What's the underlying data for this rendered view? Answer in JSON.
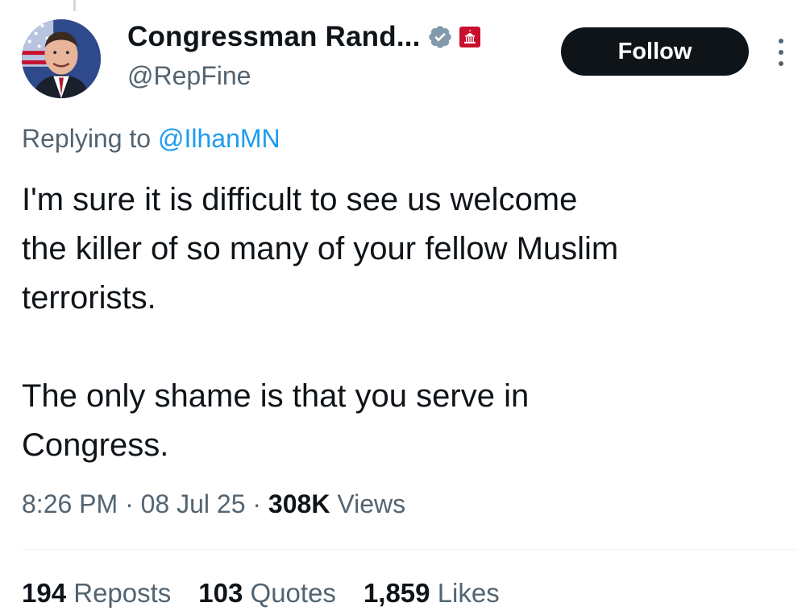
{
  "author": {
    "display_name": "Congressman Rand...",
    "handle": "@RepFine"
  },
  "icons": {
    "verified": "verified-badge-icon",
    "affiliation": "capitol-affiliation-icon",
    "more": "more-vertical-icon"
  },
  "follow_label": "Follow",
  "reply": {
    "prefix": "Replying to",
    "mention": "@IlhanMN"
  },
  "tweet": {
    "paragraph1_line1": "I'm sure it is difficult to see us welcome",
    "paragraph1_line2": "the killer of so many of your fellow Muslim",
    "paragraph1_line3": "terrorists.",
    "paragraph2_line1": "The only shame is that you serve in",
    "paragraph2_line2": "Congress."
  },
  "meta": {
    "time": "8:26 PM",
    "date": "08 Jul 25",
    "views_count": "308K",
    "views_label": "Views"
  },
  "stats": {
    "reposts_count": "194",
    "reposts_label": "Reposts",
    "quotes_count": "103",
    "quotes_label": "Quotes",
    "likes_count": "1,859",
    "likes_label": "Likes"
  },
  "colors": {
    "text_primary": "#0f1419",
    "text_secondary": "#536471",
    "link": "#1d9bf0",
    "verified_badge": "#829aab",
    "affiliation_badge": "#c8102e",
    "follow_bg": "#0f1419"
  }
}
